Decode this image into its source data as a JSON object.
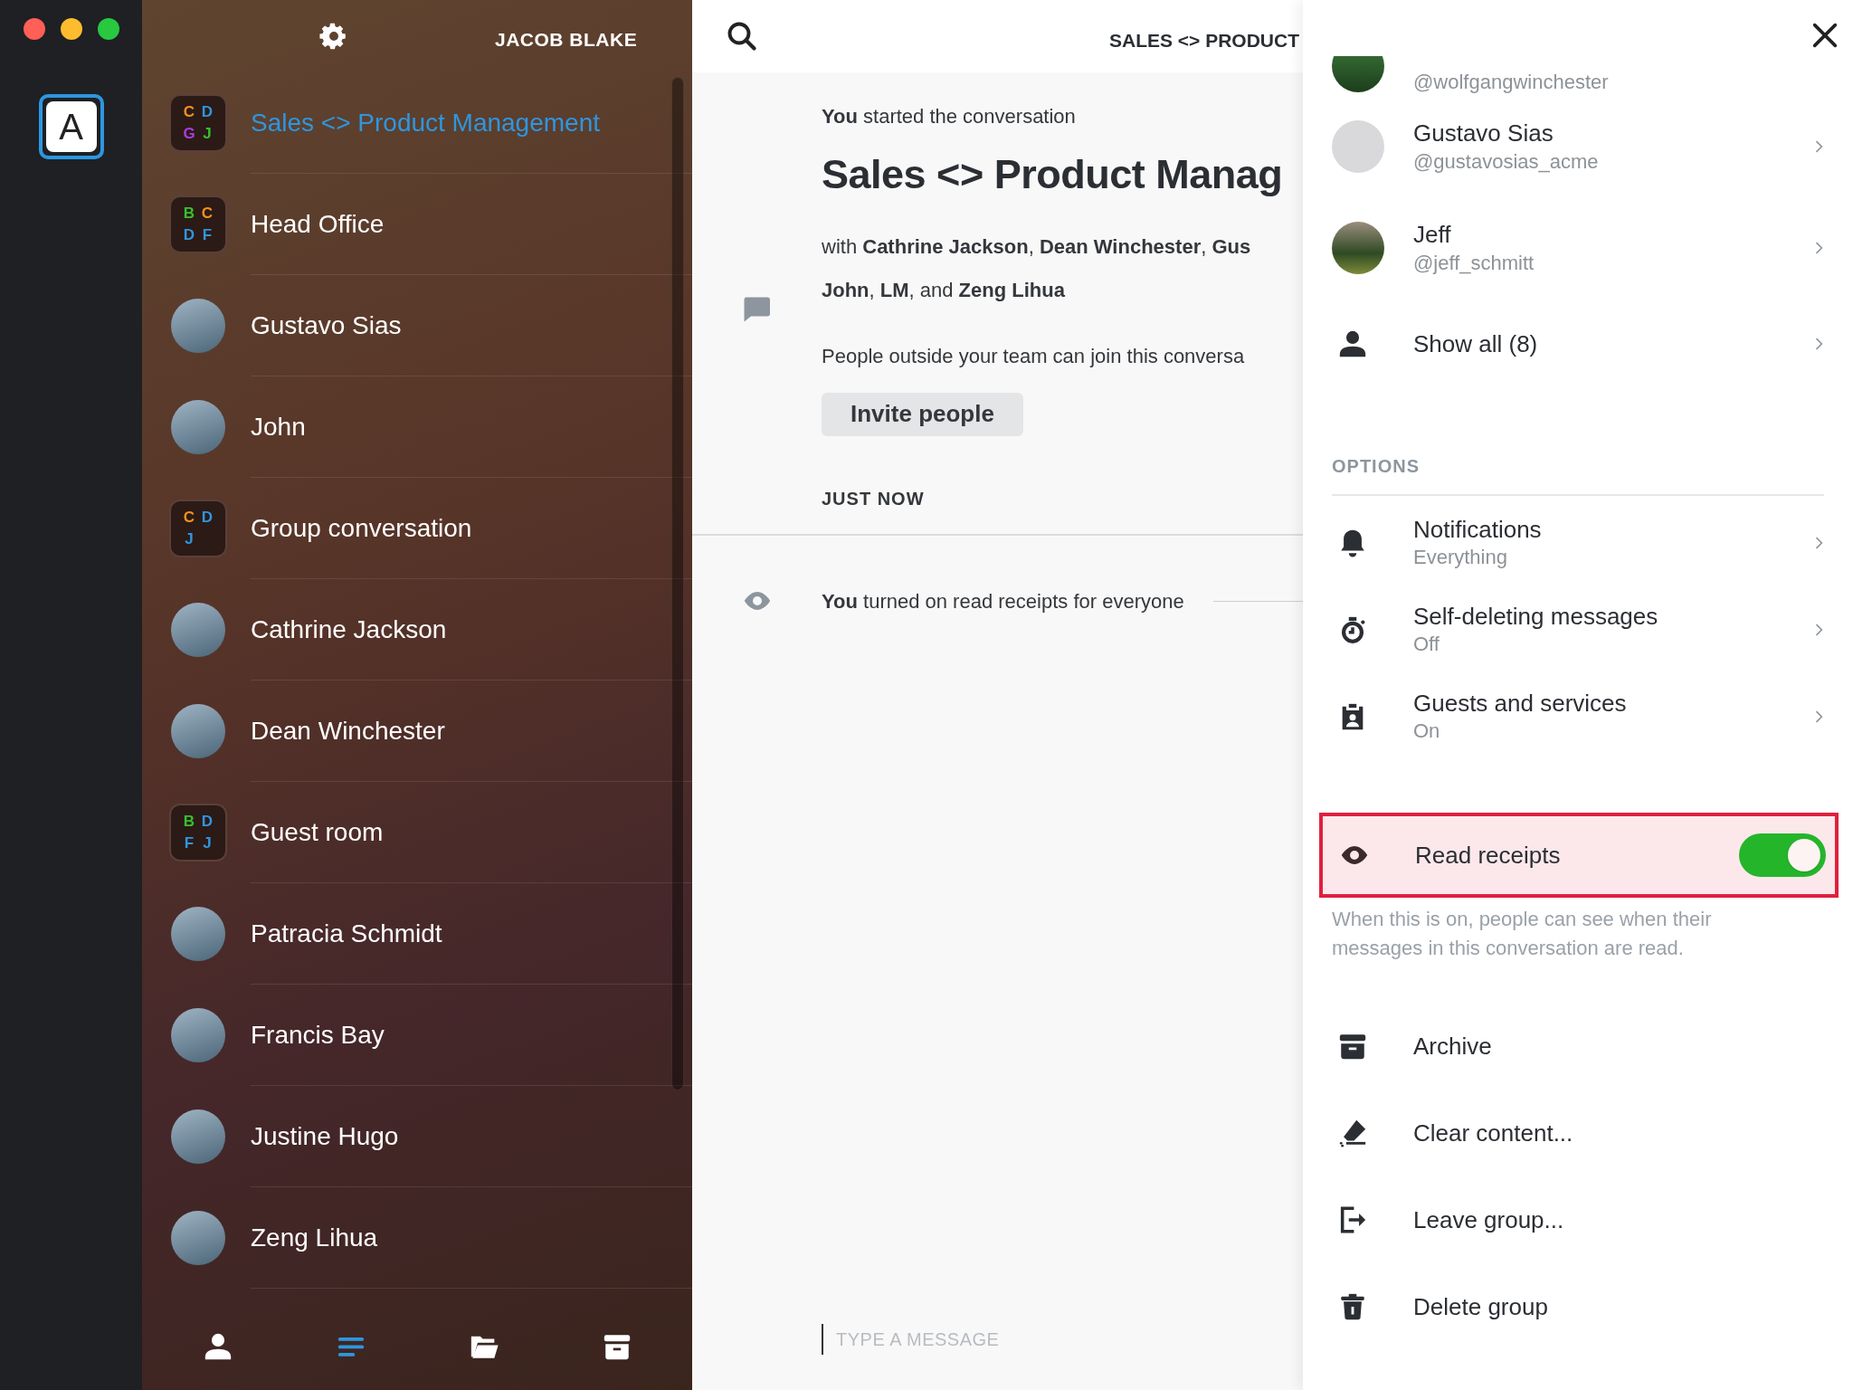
{
  "window": {
    "account_name": "JACOB BLAKE"
  },
  "team_rail": {
    "teams": [
      {
        "initial": "A",
        "selected": true
      }
    ]
  },
  "conversations": [
    {
      "kind": "group",
      "name": "Sales <> Product Management",
      "selected": true,
      "initials": [
        {
          "letter": "C",
          "color": "#f5901e"
        },
        {
          "letter": "D",
          "color": "#2e96e0"
        },
        {
          "letter": "G",
          "color": "#a93de0"
        },
        {
          "letter": "J",
          "color": "#37c02e"
        }
      ]
    },
    {
      "kind": "group",
      "name": "Head Office",
      "selected": false,
      "initials": [
        {
          "letter": "B",
          "color": "#37c02e"
        },
        {
          "letter": "C",
          "color": "#f5901e"
        },
        {
          "letter": "D",
          "color": "#2e96e0"
        },
        {
          "letter": "F",
          "color": "#2e96e0"
        }
      ]
    },
    {
      "kind": "person",
      "name": "Gustavo Sias",
      "selected": false
    },
    {
      "kind": "person",
      "name": "John",
      "selected": false
    },
    {
      "kind": "group",
      "name": "Group conversation",
      "selected": false,
      "initials": [
        {
          "letter": "C",
          "color": "#f5901e"
        },
        {
          "letter": "D",
          "color": "#2e96e0"
        },
        {
          "letter": "J",
          "color": "#2e96e0"
        }
      ]
    },
    {
      "kind": "person",
      "name": "Cathrine Jackson",
      "selected": false
    },
    {
      "kind": "person",
      "name": "Dean Winchester",
      "selected": false
    },
    {
      "kind": "group",
      "name": "Guest room",
      "selected": false,
      "initials": [
        {
          "letter": "B",
          "color": "#37c02e"
        },
        {
          "letter": "D",
          "color": "#2e96e0"
        },
        {
          "letter": "F",
          "color": "#2e96e0"
        },
        {
          "letter": "J",
          "color": "#2e96e0"
        }
      ]
    },
    {
      "kind": "person",
      "name": "Patracia Schmidt",
      "selected": false
    },
    {
      "kind": "person",
      "name": "Francis Bay",
      "selected": false
    },
    {
      "kind": "person",
      "name": "Justine Hugo",
      "selected": false
    },
    {
      "kind": "person",
      "name": "Zeng Lihua",
      "selected": false
    }
  ],
  "bottom_nav": [
    {
      "selected": false
    },
    {
      "selected": true
    },
    {
      "selected": false
    },
    {
      "selected": false
    }
  ],
  "conversation": {
    "header_title": "SALES <> PRODUCT",
    "started": "**You** started the conversation",
    "title": "Sales <> Product Manag",
    "participants": [
      "with **Cathrine Jackson**, **Dean Winchester**, **Gus**",
      "**John**, **LM**, and **Zeng Lihua**"
    ],
    "guest_note": "People outside your team can join this conversa",
    "invite_button": "Invite people",
    "timestamp": "JUST NOW",
    "system_message": "**You** turned on read receipts for everyone",
    "composer": {
      "placeholder": "TYPE A MESSAGE"
    }
  },
  "details_panel": {
    "members": [
      {
        "handle": "@wolfgangwinchester"
      },
      {
        "name": "Gustavo Sias",
        "handle": "@gustavosias_acme"
      },
      {
        "name": "Jeff",
        "handle": "@jeff_schmitt"
      }
    ],
    "show_all": "Show all (8)",
    "options_heading": "OPTIONS",
    "options": [
      {
        "title": "Notifications",
        "value": "Everything"
      },
      {
        "title": "Self-deleting messages",
        "value": "Off"
      },
      {
        "title": "Guests and services",
        "value": "On"
      }
    ],
    "read_receipts": {
      "label": "Read receipts",
      "on": true,
      "highlighted": true,
      "description": "When this is on, people can see when their messages in this conversation are read."
    },
    "actions": [
      {
        "label": "Archive"
      },
      {
        "label": "Clear content..."
      },
      {
        "label": "Leave group..."
      },
      {
        "label": "Delete group"
      }
    ]
  }
}
